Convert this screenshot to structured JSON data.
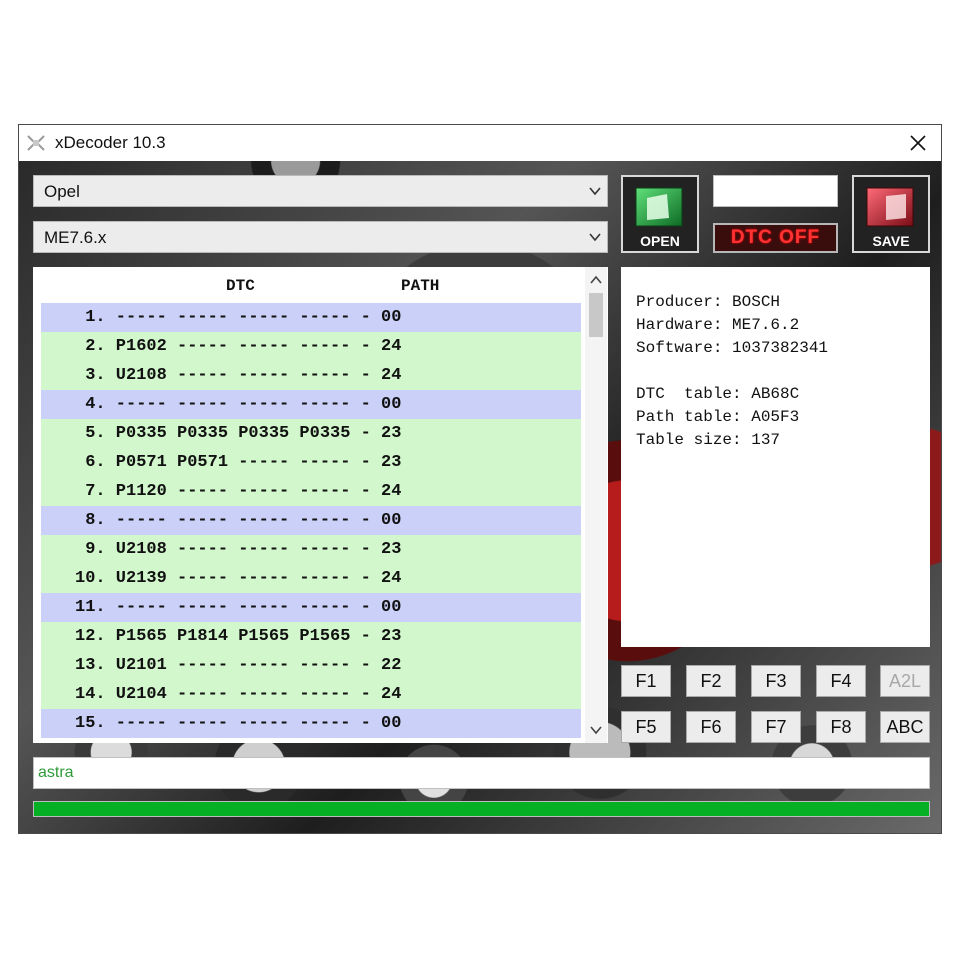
{
  "window": {
    "title": "xDecoder 10.3"
  },
  "dropdowns": {
    "manufacturer": "Opel",
    "ecu": "ME7.6.x"
  },
  "buttons": {
    "open_label": "OPEN",
    "save_label": "SAVE",
    "dtc_off_label": "DTC OFF"
  },
  "dtc_input": {
    "value": ""
  },
  "table": {
    "headers": {
      "dtc": "DTC",
      "path": "PATH"
    },
    "rows": [
      {
        "text": " 1. ----- ----- ----- ----- - 00",
        "color": "#cbd0f8"
      },
      {
        "text": " 2. P1602 ----- ----- ----- - 24",
        "color": "#d2f7cc"
      },
      {
        "text": " 3. U2108 ----- ----- ----- - 24",
        "color": "#d2f7cc"
      },
      {
        "text": " 4. ----- ----- ----- ----- - 00",
        "color": "#cbd0f8"
      },
      {
        "text": " 5. P0335 P0335 P0335 P0335 - 23",
        "color": "#d2f7cc"
      },
      {
        "text": " 6. P0571 P0571 ----- ----- - 23",
        "color": "#d2f7cc"
      },
      {
        "text": " 7. P1120 ----- ----- ----- - 24",
        "color": "#d2f7cc"
      },
      {
        "text": " 8. ----- ----- ----- ----- - 00",
        "color": "#cbd0f8"
      },
      {
        "text": " 9. U2108 ----- ----- ----- - 23",
        "color": "#d2f7cc"
      },
      {
        "text": "10. U2139 ----- ----- ----- - 24",
        "color": "#d2f7cc"
      },
      {
        "text": "11. ----- ----- ----- ----- - 00",
        "color": "#cbd0f8"
      },
      {
        "text": "12. P1565 P1814 P1565 P1565 - 23",
        "color": "#d2f7cc"
      },
      {
        "text": "13. U2101 ----- ----- ----- - 22",
        "color": "#d2f7cc"
      },
      {
        "text": "14. U2104 ----- ----- ----- - 24",
        "color": "#d2f7cc"
      },
      {
        "text": "15. ----- ----- ----- ----- - 00",
        "color": "#cbd0f8"
      }
    ]
  },
  "info": {
    "producer": "Producer: BOSCH",
    "hardware": "Hardware: ME7.6.2",
    "software": "Software: 1037382341",
    "dtc_table": "DTC  table: AB68C",
    "path_table": "Path table: A05F3",
    "table_size": "Table size: 137"
  },
  "function_keys": {
    "f1": "F1",
    "f2": "F2",
    "f3": "F3",
    "f4": "F4",
    "a2l": "A2L",
    "f5": "F5",
    "f6": "F6",
    "f7": "F7",
    "f8": "F8",
    "abc": "ABC"
  },
  "search": {
    "value": "astra"
  },
  "progress": {
    "value": 1.0,
    "color": "#06b025"
  },
  "colors": {
    "row_blue": "#cbd0f8",
    "row_green": "#d2f7cc",
    "dtc_off_text": "#ff3333",
    "open_icon": "#1e9e3e",
    "save_icon": "#b0202a"
  },
  "icons": {
    "app": "app-icon",
    "close": "close-icon",
    "open": "open-folder-icon",
    "save": "save-folder-icon",
    "dropdown": "chevron-down-icon"
  }
}
